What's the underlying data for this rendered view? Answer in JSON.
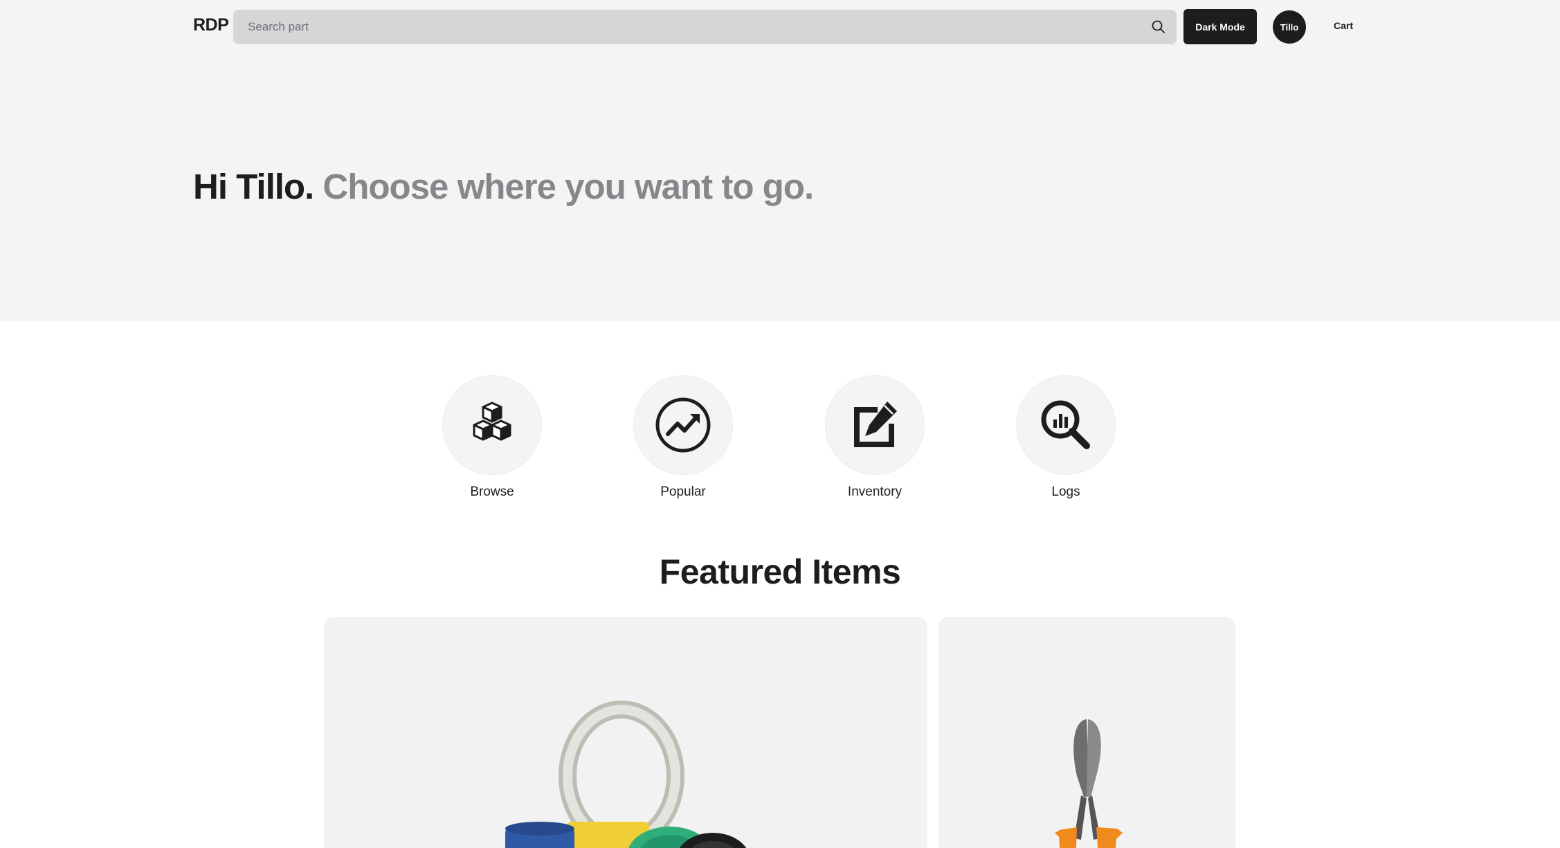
{
  "header": {
    "logo": "RDP",
    "search_placeholder": "Search part",
    "dark_mode_label": "Dark Mode",
    "user_name": "Tillo",
    "cart_label": "Cart"
  },
  "hero": {
    "greeting": "Hi Tillo.",
    "subtitle": "Choose where you want to go."
  },
  "quick_links": [
    {
      "label": "Browse",
      "icon": "cubes-icon"
    },
    {
      "label": "Popular",
      "icon": "trending-up-icon"
    },
    {
      "label": "Inventory",
      "icon": "edit-icon"
    },
    {
      "label": "Logs",
      "icon": "search-chart-icon"
    }
  ],
  "featured": {
    "title": "Featured Items",
    "items": [
      {
        "image": "wire-spools"
      },
      {
        "image": "pliers"
      }
    ]
  },
  "colors": {
    "background_light": "#f4f4f4",
    "dark": "#1d1d1f",
    "muted_text": "#86868b",
    "search_bg": "#d6d6d9"
  }
}
